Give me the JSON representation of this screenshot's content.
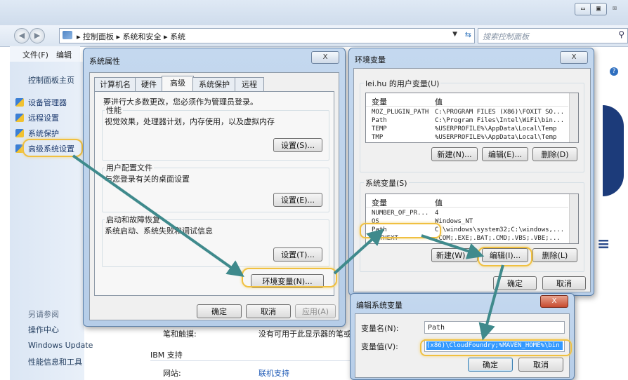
{
  "window": {
    "minimize": "▭",
    "maximize": "▣",
    "close": "☒",
    "breadcrumb": [
      "控制面板",
      "系统和安全",
      "系统"
    ],
    "search_placeholder": "搜索控制面板",
    "menu": [
      "文件(F)",
      "编辑(E)"
    ]
  },
  "sidebar": {
    "home": "控制面板主页",
    "items": [
      "设备管理器",
      "远程设置",
      "系统保护",
      "高级系统设置"
    ],
    "see_also": "另请参阅",
    "links": [
      "操作中心",
      "Windows Update",
      "性能信息和工具"
    ]
  },
  "content": {
    "pen_label": "笔和触摸:",
    "pen_value": "没有可用于此显示器的笔或",
    "ibm_support": "IBM 支持",
    "website_label": "网站:",
    "website_value": "联机支持"
  },
  "sysprops": {
    "title": "系统属性",
    "close": "X",
    "tabs": [
      "计算机名",
      "硬件",
      "高级",
      "系统保护",
      "远程"
    ],
    "admin_note": "要进行大多数更改，您必须作为管理员登录。",
    "perf_title": "性能",
    "perf_desc": "视觉效果，处理器计划，内存使用，以及虚拟内存",
    "perf_btn": "设置(S)...",
    "profile_title": "用户配置文件",
    "profile_desc": "与您登录有关的桌面设置",
    "profile_btn": "设置(E)...",
    "startup_title": "启动和故障恢复",
    "startup_desc": "系统启动、系统失败和调试信息",
    "startup_btn": "设置(T)...",
    "env_btn": "环境变量(N)...",
    "ok": "确定",
    "cancel": "取消",
    "apply": "应用(A)"
  },
  "envvars": {
    "title": "环境变量",
    "close": "X",
    "user_title": "lei.hu 的用户变量(U)",
    "col_var": "变量",
    "col_val": "值",
    "user_rows": [
      {
        "name": "MOZ_PLUGIN_PATH",
        "value": "C:\\PROGRAM FILES (X86)\\FOXIT SO..."
      },
      {
        "name": "Path",
        "value": "C:\\Program Files\\Intel\\WiFi\\bin..."
      },
      {
        "name": "TEMP",
        "value": "%USERPROFILE%\\AppData\\Local\\Temp"
      },
      {
        "name": "TMP",
        "value": "%USERPROFILE%\\AppData\\Local\\Temp"
      }
    ],
    "user_new": "新建(N)...",
    "user_edit": "编辑(E)...",
    "user_delete": "删除(D)",
    "sys_title": "系统变量(S)",
    "sys_rows": [
      {
        "name": "NUMBER_OF_PR...",
        "value": "4"
      },
      {
        "name": "OS",
        "value": "Windows_NT"
      },
      {
        "name": "Path",
        "value": "C:\\windows\\system32;C:\\windows,..."
      },
      {
        "name": "PATHEXT",
        "value": ".COM;.EXE;.BAT;.CMD;.VBS;.VBE;..."
      }
    ],
    "sys_new": "新建(W)...",
    "sys_edit": "编辑(I)...",
    "sys_delete": "删除(L)",
    "ok": "确定",
    "cancel": "取消"
  },
  "editvar": {
    "title": "编辑系统变量",
    "close": "X",
    "name_label": "变量名(N):",
    "name_value": "Path",
    "value_label": "变量值(V):",
    "value_value": "(x86)\\CloudFoundry;%MAVEN_HOME%\\bin",
    "ok": "确定",
    "cancel": "取消"
  },
  "colors": {
    "arrow": "#3f8a8c",
    "highlight": "#f0c040",
    "selection": "#3399ff",
    "link": "#1c58b5"
  }
}
